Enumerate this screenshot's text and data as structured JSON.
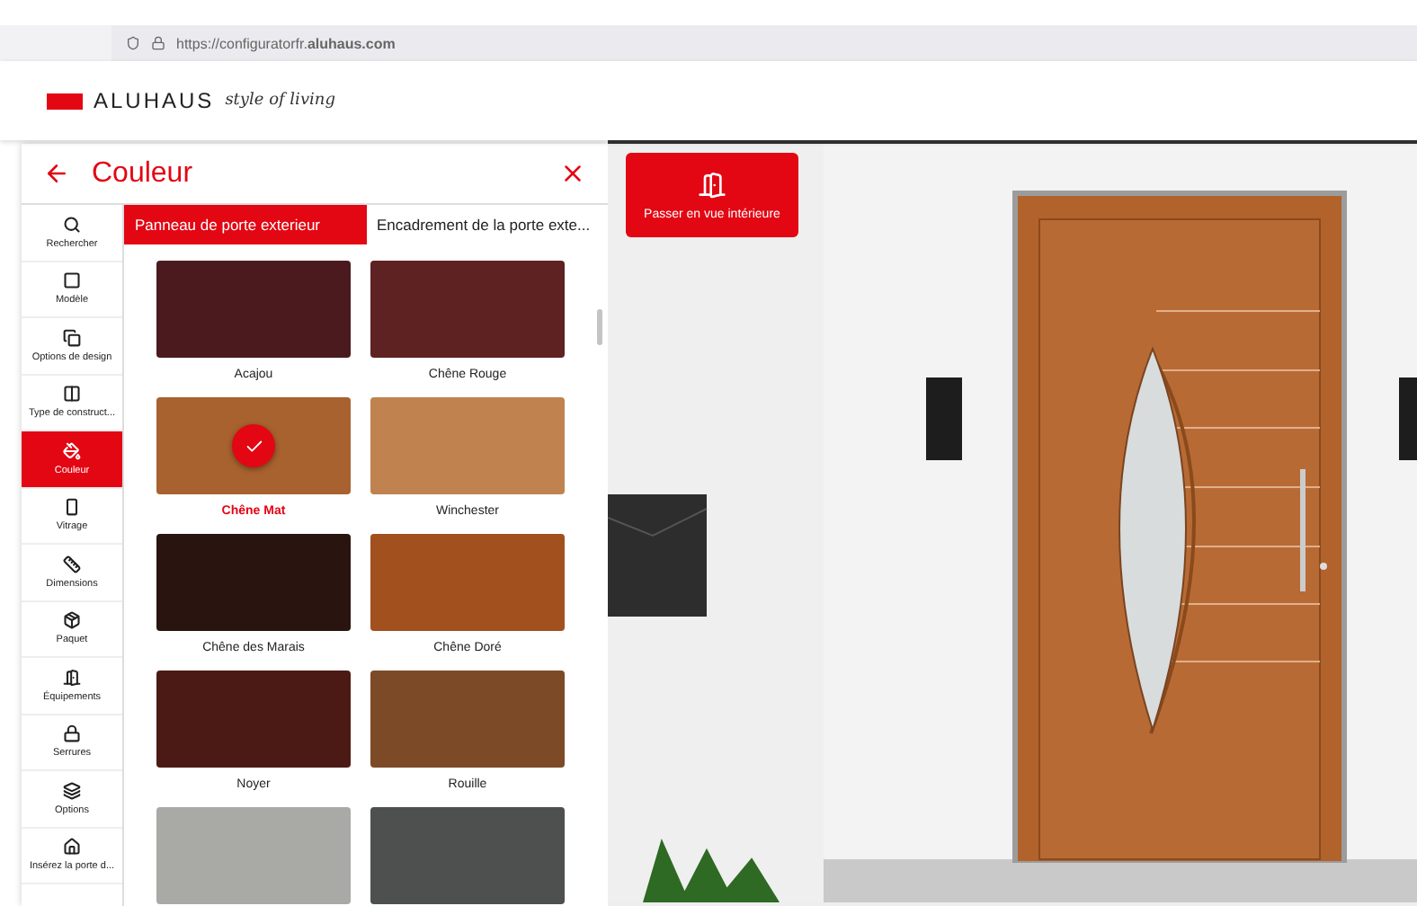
{
  "browser": {
    "url": "https://configuratorfr.**aluhaus.com**"
  },
  "header": {
    "brand": "ALUHAUS",
    "tagline": "style of living"
  },
  "panel": {
    "title": "Couleur"
  },
  "tabs": [
    {
      "label": "Panneau de porte exterieur",
      "selected": true
    },
    {
      "label": "Encadrement de la porte exte...",
      "selected": false
    }
  ],
  "sidebar": {
    "items": [
      {
        "label": "Rechercher",
        "kind": "search",
        "selected": false
      },
      {
        "label": "Modèle",
        "kind": "model",
        "selected": false
      },
      {
        "label": "Options de design",
        "kind": "design",
        "selected": false
      },
      {
        "label": "Type de construct...",
        "kind": "construction",
        "selected": false
      },
      {
        "label": "Couleur",
        "kind": "color",
        "selected": true
      },
      {
        "label": "Vitrage",
        "kind": "glazing",
        "selected": false
      },
      {
        "label": "Dimensions",
        "kind": "dimensions",
        "selected": false
      },
      {
        "label": "Paquet",
        "kind": "package",
        "selected": false
      },
      {
        "label": "Équipements",
        "kind": "equipment",
        "selected": false
      },
      {
        "label": "Serrures",
        "kind": "lock",
        "selected": false
      },
      {
        "label": "Options",
        "kind": "options",
        "selected": false
      },
      {
        "label": "Insérez la porte d...",
        "kind": "house",
        "selected": false
      }
    ]
  },
  "swatches": [
    {
      "name": "Acajou",
      "color": "#4a1a1e",
      "selected": false
    },
    {
      "name": "Chêne Rouge",
      "color": "#5e2222",
      "selected": false
    },
    {
      "name": "Chêne Mat",
      "color": "#a8622f",
      "selected": true
    },
    {
      "name": "Winchester",
      "color": "#c08350",
      "selected": false
    },
    {
      "name": "Chêne des Marais",
      "color": "#2a1410",
      "selected": false
    },
    {
      "name": "Chêne Doré",
      "color": "#a2501e",
      "selected": false
    },
    {
      "name": "Noyer",
      "color": "#4c1a14",
      "selected": false
    },
    {
      "name": "Rouille",
      "color": "#7c4a26",
      "selected": false
    },
    {
      "color": "#a9aaa6",
      "selected": false
    },
    {
      "color": "#4e5050",
      "selected": false
    }
  ],
  "scene": {
    "button": "Passer en vue intérieure"
  }
}
